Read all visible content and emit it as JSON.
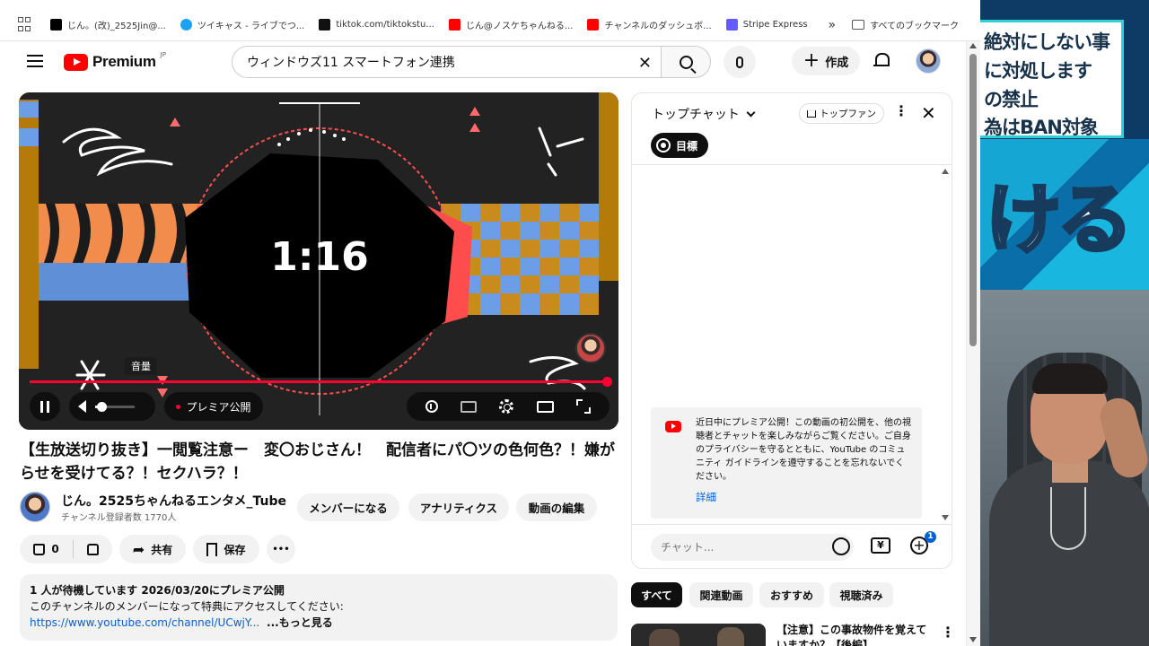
{
  "bookmarks": [
    {
      "label": "じん。(改)_2525Jin@...",
      "color": "#000000"
    },
    {
      "label": "ツイキャス - ライブでつ...",
      "color": "#1da1f2"
    },
    {
      "label": "tiktok.com/tiktokstu...",
      "color": "#111111"
    },
    {
      "label": "じん@ノスケちゃんねる...",
      "color": "#ff0000"
    },
    {
      "label": "チャンネルのダッシュボ...",
      "color": "#ff0000"
    },
    {
      "label": "Stripe Express",
      "color": "#635bff"
    }
  ],
  "bookmarks_more": "»",
  "bookmarks_all": "すべてのブックマーク",
  "header": {
    "logo_text": "Premium",
    "logo_region": "JP",
    "search_value": "ウィンドウズ11 スマートフォン連携",
    "search_clear": "✕",
    "create_label": "作成",
    "create_plus": "+"
  },
  "player": {
    "countdown": "1:16",
    "volume_tooltip": "音量",
    "volume_level": 0.15,
    "progress": 1.0,
    "premiere_label": "プレミア公開"
  },
  "video": {
    "title": "【生放送切り抜き】一閲覧注意ー　変〇おじさん！　配信者にパ〇ツの色何色？！嫌がらせを受けてる？！セクハラ？！",
    "channel_name": "じん。2525ちゃんねるエンタメ_Tube",
    "subscribers": "チャンネル登録者数 1770人",
    "buttons": {
      "member": "メンバーになる",
      "analytics": "アナリティクス",
      "edit": "動画の編集"
    },
    "like_count": "0",
    "share_label": "共有",
    "save_label": "保存",
    "more_label": "•••"
  },
  "description": {
    "line1": "1 人が待機しています  2026/03/20にプレミア公開",
    "line2": "このチャンネルのメンバーになって特典にアクセスしてください:",
    "link": "https://www.youtube.com/channel/UCwjY...",
    "more": "...もっと見る"
  },
  "chat": {
    "title": "トップチャット",
    "topfan_label": "トップファン",
    "goal_label": "目標",
    "notice_text": "近日中にプレミア公開！この動画の初公開を、他の視聴者とチャットを楽しみながらご覧ください。ご自身のプライバシーを守るとともに、YouTube のコミュニティ ガイドラインを遵守することを忘れないでください。",
    "notice_link": "詳細",
    "input_placeholder": "チャット...",
    "yen_label": "¥",
    "badge_count": "1"
  },
  "filters": [
    "すべて",
    "関連動画",
    "おすすめ",
    "視聴済み"
  ],
  "related": {
    "title": "【注意】この事故物件を覚えていますか？【後編】"
  },
  "overlay": {
    "rules": [
      "絶対にしない事",
      "に対処します",
      "の禁止",
      "為はBAN対象"
    ],
    "banner_text": "ける"
  }
}
